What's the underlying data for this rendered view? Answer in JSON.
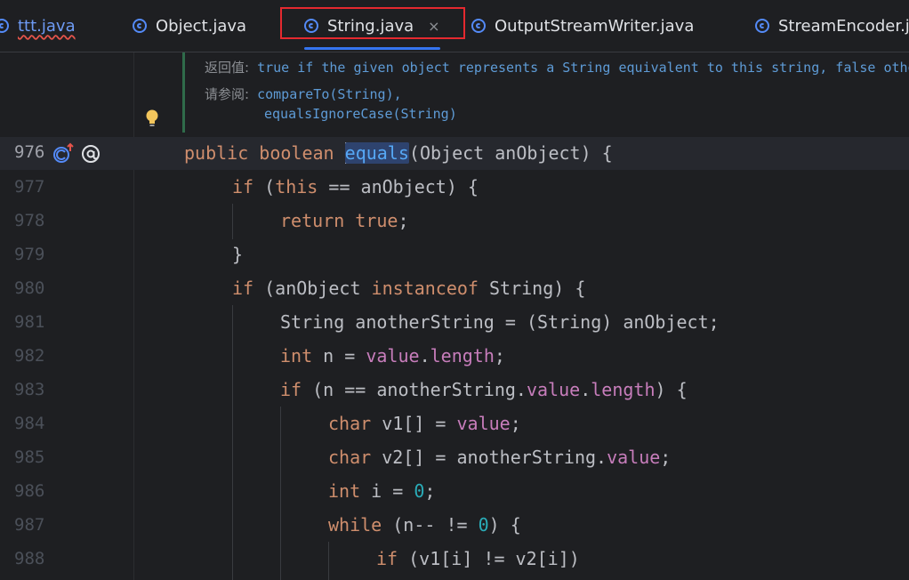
{
  "tabs": [
    {
      "label": "ttt.java",
      "error": true
    },
    {
      "label": "Object.java"
    },
    {
      "label": "String.java",
      "active": true,
      "close": "×"
    },
    {
      "label": "OutputStreamWriter.java"
    },
    {
      "label": "StreamEncoder.j"
    }
  ],
  "doc": {
    "returns_label": "返回值:",
    "returns_text": "true if the given object represents a String equivalent to this string, false otherwi",
    "see_label": "请参阅:",
    "see_1": "compareTo(String),",
    "see_2": "equalsIgnoreCase(String)"
  },
  "line_numbers": [
    "976",
    "977",
    "978",
    "979",
    "980",
    "981",
    "982",
    "983",
    "984",
    "985",
    "986",
    "987",
    "988"
  ],
  "code": {
    "l976": {
      "mod": "public",
      "type": "boolean",
      "name_e": "e",
      "name_rest": "quals",
      "params": "(Object anObject) {"
    },
    "l977": {
      "kw": "if",
      "a": " (",
      "this": "this",
      "b": " == anObject) {"
    },
    "l978": {
      "kw": "return",
      "sp": " ",
      "val": "true",
      "end": ";"
    },
    "l979": {
      "text": "}"
    },
    "l980": {
      "kw": "if",
      "a": " (anObject ",
      "kw2": "instanceof",
      "b": " String) {"
    },
    "l981": {
      "text": "String anotherString = (String) anObject;"
    },
    "l982": {
      "kw": "int",
      "a": " n = ",
      "fld": "value",
      "dot": ".",
      "fld2": "length",
      "end": ";"
    },
    "l983": {
      "kw": "if",
      "a": " (n == anotherString.",
      "fld": "value",
      "dot": ".",
      "fld2": "length",
      "b": ") {"
    },
    "l984": {
      "kw": "char",
      "a": " v1[] = ",
      "fld": "value",
      "end": ";"
    },
    "l985": {
      "kw": "char",
      "a": " v2[] = anotherString.",
      "fld": "value",
      "end": ";"
    },
    "l986": {
      "kw": "int",
      "a": " i = ",
      "num": "0",
      "end": ";"
    },
    "l987": {
      "kw": "while",
      "a": " (n-- != ",
      "num": "0",
      "b": ") {"
    },
    "l988": {
      "kw": "if",
      "a": " (v1[i] != v2[i])"
    }
  },
  "colors": {
    "keyword": "#cf8e6d",
    "field": "#c77dbb",
    "number": "#2aacb8",
    "accent": "#3574f0",
    "highlight": "#e5292f"
  },
  "icons": [
    "class-icon",
    "close-icon",
    "lightbulb-icon",
    "override-icon",
    "annotation-icon"
  ]
}
